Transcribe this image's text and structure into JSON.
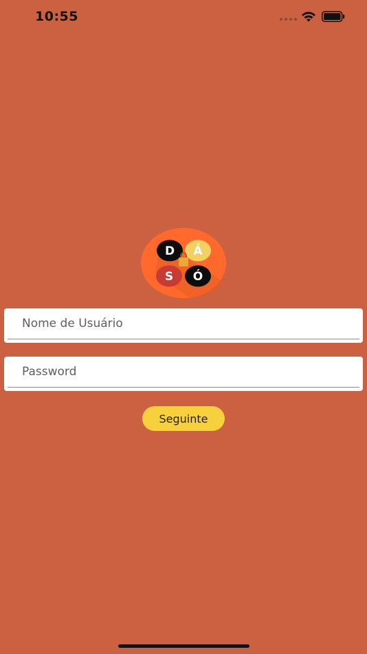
{
  "status_bar": {
    "time": "10:55",
    "icons": [
      "cellular-signal-icon",
      "wifi-icon",
      "battery-icon"
    ]
  },
  "logo": {
    "letters": [
      "D",
      "Á",
      "S",
      "Ó"
    ]
  },
  "login_form": {
    "username_placeholder": "Nome de Usuário",
    "username_value": "",
    "password_placeholder": "Password",
    "password_value": "",
    "submit_label": "Seguinte"
  },
  "colors": {
    "background": "#cc6142",
    "logo_circle": "#ff6a2c",
    "button": "#f7d03d",
    "field_background": "#ffffff"
  }
}
